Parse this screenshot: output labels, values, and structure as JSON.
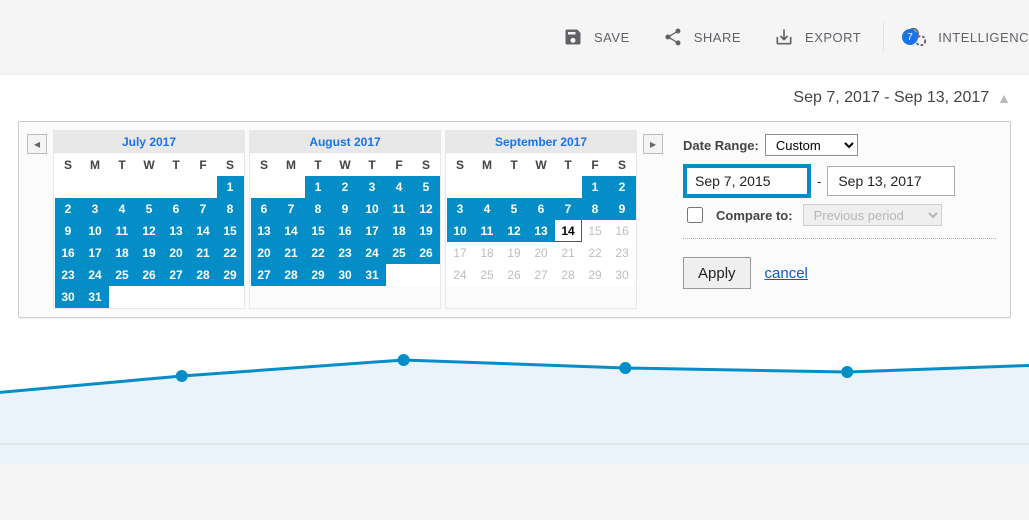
{
  "toolbar": {
    "save": "SAVE",
    "share": "SHARE",
    "export": "EXPORT",
    "intel": "INTELLIGENC",
    "badge": "7"
  },
  "date_summary": "Sep 7, 2017 - Sep 13, 2017",
  "picker": {
    "range_label": "Date Range:",
    "range_value": "Custom",
    "start": "Sep 7, 2015",
    "end": "Sep 13, 2017",
    "compare_label": "Compare to:",
    "compare_value": "Previous period",
    "apply": "Apply",
    "cancel": "cancel",
    "months": [
      {
        "title": "July 2017",
        "leading": 6,
        "count": 31,
        "sel_from": 1,
        "sel_to": 31,
        "today": null,
        "out_after": false
      },
      {
        "title": "August 2017",
        "leading": 2,
        "count": 31,
        "sel_from": 1,
        "sel_to": 31,
        "today": null,
        "out_after": false
      },
      {
        "title": "September 2017",
        "leading": 5,
        "count": 30,
        "sel_from": 1,
        "sel_to": 13,
        "today": 14,
        "out_after": true
      }
    ],
    "dow": [
      "S",
      "M",
      "T",
      "W",
      "T",
      "F",
      "S"
    ]
  },
  "colors": {
    "accent": "#058dc7"
  },
  "chart_data": {
    "type": "line",
    "x": [
      0,
      1,
      2,
      3,
      4,
      5
    ],
    "y": [
      34,
      44,
      52,
      48,
      46,
      50
    ],
    "ylim": [
      0,
      60
    ],
    "title": "",
    "xlabel": "",
    "ylabel": "",
    "grid": false,
    "color": "#058dc7"
  }
}
